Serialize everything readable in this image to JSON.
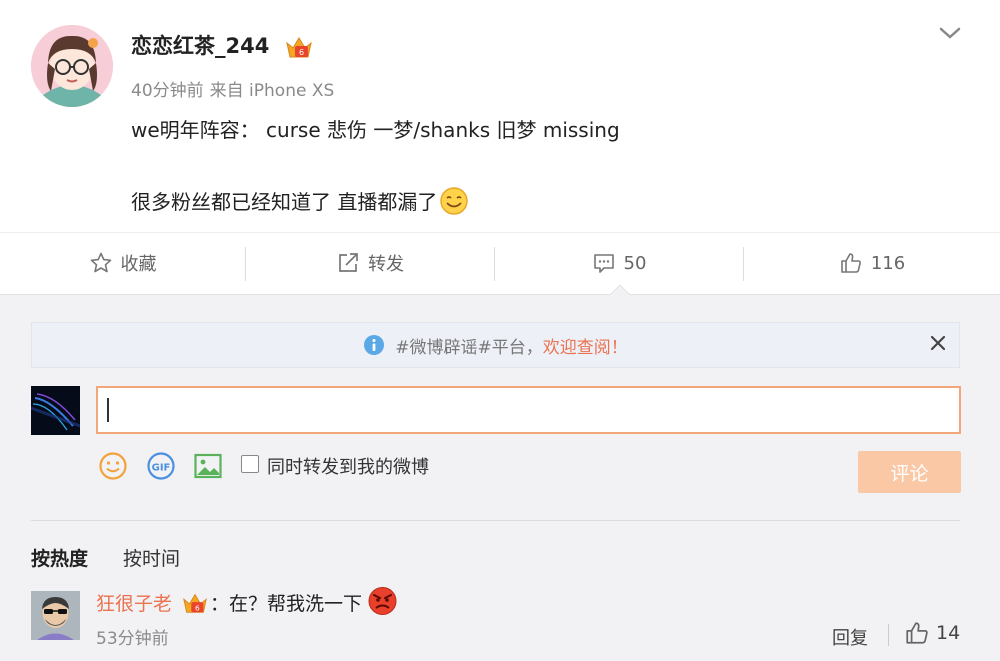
{
  "post": {
    "username": "恋恋红茶_244",
    "time": "40分钟前",
    "source": "来自 iPhone XS",
    "line1": "we明年阵容： curse 悲伤 一梦/shanks 旧梦 missing",
    "line2": "很多粉丝都已经知道了 直播都漏了"
  },
  "actions": {
    "favorite": "收藏",
    "forward": "转发",
    "comment_count": "50",
    "like_count": "116"
  },
  "notice": {
    "text": "#微博辟谣#平台，",
    "link": "欢迎查阅！"
  },
  "composer": {
    "input_value": "",
    "also_forward_label": "同时转发到我的微博",
    "submit_label": "评论"
  },
  "sort": {
    "hot": "按热度",
    "time": "按时间"
  },
  "comments": [
    {
      "name": "狂很子老",
      "text": "：在？帮我洗一下",
      "time": "53分钟前",
      "reply_label": "回复",
      "likes": "14"
    }
  ],
  "colors": {
    "accent": "#eb7350",
    "submit_disabled": "#fbc8a6",
    "panel_bg": "#f2f2f5",
    "input_border": "#f2a67a"
  }
}
